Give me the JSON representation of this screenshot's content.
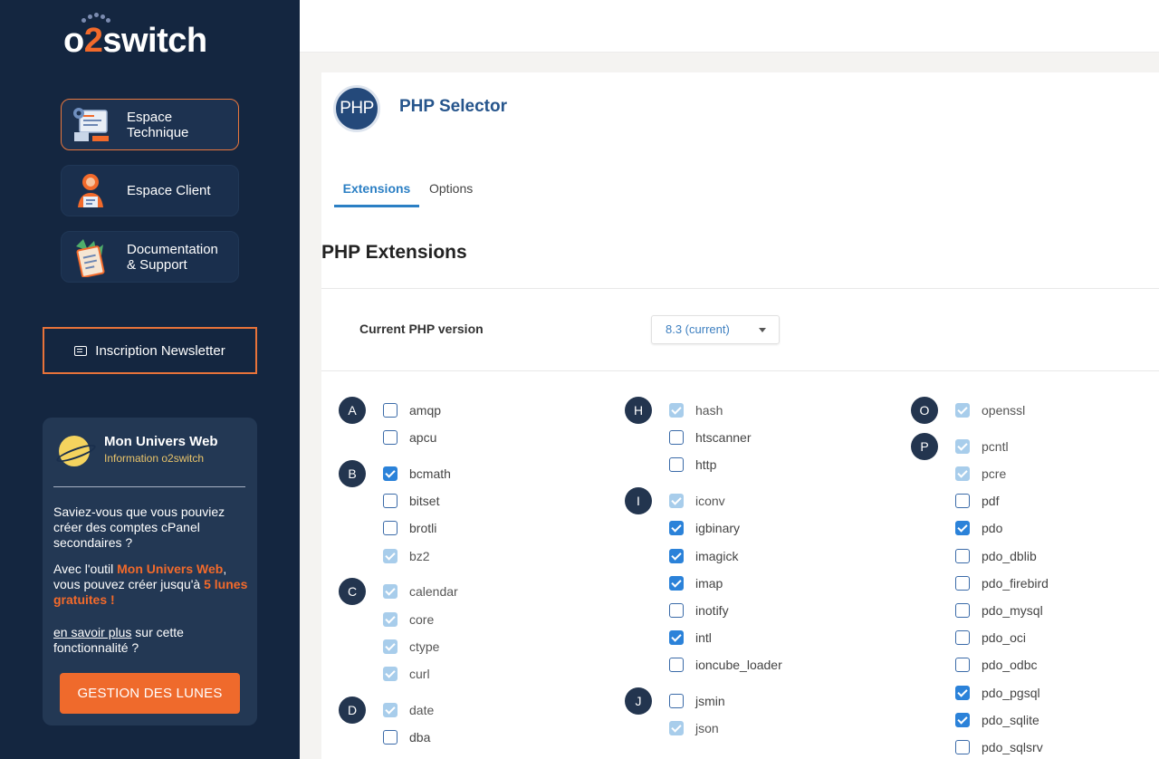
{
  "sidebar": {
    "logo_prefix": "o",
    "logo_two": "2",
    "logo_suffix": "switch",
    "nav": [
      {
        "line1": "Espace",
        "line2": "Technique",
        "icon": "technical-space-icon",
        "active": true
      },
      {
        "line1": "Espace Client",
        "line2": "",
        "icon": "client-space-icon",
        "active": false
      },
      {
        "line1": "Documentation",
        "line2": "& Support",
        "icon": "documentation-icon",
        "active": false
      }
    ],
    "newsletter_label": "Inscription Newsletter",
    "univers": {
      "title": "Mon Univers Web",
      "subtitle": "Information o2switch",
      "p1": "Saviez-vous que vous pouviez créer des comptes cPanel secondaires ?",
      "p2_a": "Avec l'outil ",
      "p2_hl1": "Mon Univers Web",
      "p2_b": ", vous pouvez créer jusqu'à ",
      "p2_hl2": "5 lunes gratuites !",
      "p3_link": "en savoir plus",
      "p3_rest": " sur cette fonctionnalité ?",
      "button": "GESTION DES LUNES"
    }
  },
  "header": {
    "logo_text": "PHP",
    "title": "PHP Selector"
  },
  "tabs": [
    {
      "label": "Extensions",
      "active": true
    },
    {
      "label": "Options",
      "active": false
    }
  ],
  "section_title": "PHP Extensions",
  "version": {
    "label": "Current PHP version",
    "value": "8.3 (current)"
  },
  "colors": {
    "sidebar_bg": "#142640",
    "accent": "#ef6a2c",
    "link_blue": "#2b7fc4",
    "checkbox_on": "#2b82d9",
    "checkbox_disabled": "#a8cdeb"
  },
  "groups": [
    {
      "letter": "A",
      "items": [
        {
          "name": "amqp",
          "state": "off"
        },
        {
          "name": "apcu",
          "state": "off"
        }
      ]
    },
    {
      "letter": "B",
      "items": [
        {
          "name": "bcmath",
          "state": "on"
        },
        {
          "name": "bitset",
          "state": "off"
        },
        {
          "name": "brotli",
          "state": "off"
        },
        {
          "name": "bz2",
          "state": "disabled"
        }
      ]
    },
    {
      "letter": "C",
      "items": [
        {
          "name": "calendar",
          "state": "disabled"
        },
        {
          "name": "core",
          "state": "disabled"
        },
        {
          "name": "ctype",
          "state": "disabled"
        },
        {
          "name": "curl",
          "state": "disabled"
        }
      ]
    },
    {
      "letter": "D",
      "items": [
        {
          "name": "date",
          "state": "disabled"
        },
        {
          "name": "dba",
          "state": "off"
        }
      ]
    },
    {
      "letter": "H",
      "items": [
        {
          "name": "hash",
          "state": "disabled"
        },
        {
          "name": "htscanner",
          "state": "off"
        },
        {
          "name": "http",
          "state": "off"
        }
      ]
    },
    {
      "letter": "I",
      "items": [
        {
          "name": "iconv",
          "state": "disabled"
        },
        {
          "name": "igbinary",
          "state": "on"
        },
        {
          "name": "imagick",
          "state": "on"
        },
        {
          "name": "imap",
          "state": "on"
        },
        {
          "name": "inotify",
          "state": "off"
        },
        {
          "name": "intl",
          "state": "on"
        },
        {
          "name": "ioncube_loader",
          "state": "off"
        }
      ]
    },
    {
      "letter": "J",
      "items": [
        {
          "name": "jsmin",
          "state": "off"
        },
        {
          "name": "json",
          "state": "disabled"
        }
      ]
    },
    {
      "letter": "O",
      "items": [
        {
          "name": "openssl",
          "state": "disabled"
        }
      ]
    },
    {
      "letter": "P",
      "items": [
        {
          "name": "pcntl",
          "state": "disabled"
        },
        {
          "name": "pcre",
          "state": "disabled"
        },
        {
          "name": "pdf",
          "state": "off"
        },
        {
          "name": "pdo",
          "state": "on"
        },
        {
          "name": "pdo_dblib",
          "state": "off"
        },
        {
          "name": "pdo_firebird",
          "state": "off"
        },
        {
          "name": "pdo_mysql",
          "state": "off"
        },
        {
          "name": "pdo_oci",
          "state": "off"
        },
        {
          "name": "pdo_odbc",
          "state": "off"
        },
        {
          "name": "pdo_pgsql",
          "state": "on"
        },
        {
          "name": "pdo_sqlite",
          "state": "on"
        },
        {
          "name": "pdo_sqlsrv",
          "state": "off"
        }
      ]
    }
  ]
}
